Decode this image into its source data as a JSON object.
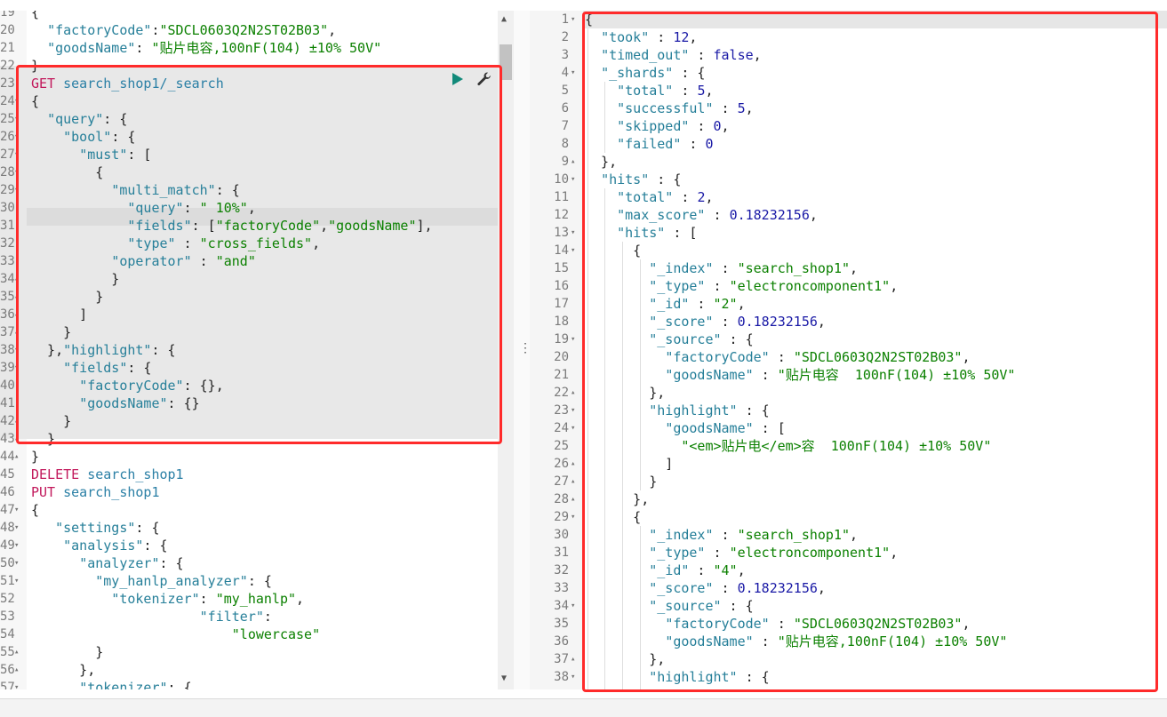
{
  "left_editor": {
    "lines": [
      {
        "n": "19",
        "fold": "",
        "text": "{"
      },
      {
        "n": "20",
        "fold": "",
        "text": "  \"factoryCode\":\"SDCL0603Q2N2ST02B03\","
      },
      {
        "n": "21",
        "fold": "",
        "text": "  \"goodsName\": \"贴片电容,100nF(104) ±10% 50V\""
      },
      {
        "n": "22",
        "fold": "",
        "text": "}"
      },
      {
        "n": "23",
        "fold": "",
        "text": "GET search_shop1/_search"
      },
      {
        "n": "24",
        "fold": "▾",
        "text": "{"
      },
      {
        "n": "25",
        "fold": "▾",
        "text": "  \"query\": {"
      },
      {
        "n": "26",
        "fold": "▾",
        "text": "    \"bool\": {"
      },
      {
        "n": "27",
        "fold": "▾",
        "text": "      \"must\": ["
      },
      {
        "n": "28",
        "fold": "▾",
        "text": "        {"
      },
      {
        "n": "29",
        "fold": "▾",
        "text": "          \"multi_match\": {"
      },
      {
        "n": "30",
        "fold": "",
        "text": "            \"query\": \" 10%\","
      },
      {
        "n": "31",
        "fold": "",
        "text": "            \"fields\": [\"factoryCode\",\"goodsName\"],"
      },
      {
        "n": "32",
        "fold": "",
        "text": "            \"type\" : \"cross_fields\","
      },
      {
        "n": "33",
        "fold": "",
        "text": "          \"operator\" : \"and\""
      },
      {
        "n": "34",
        "fold": "▴",
        "text": "          }"
      },
      {
        "n": "35",
        "fold": "▴",
        "text": "        }"
      },
      {
        "n": "36",
        "fold": "▴",
        "text": "      ]"
      },
      {
        "n": "37",
        "fold": "▴",
        "text": "    }"
      },
      {
        "n": "38",
        "fold": "▾",
        "text": "  },\"highlight\": {"
      },
      {
        "n": "39",
        "fold": "▾",
        "text": "    \"fields\": {"
      },
      {
        "n": "40",
        "fold": "",
        "text": "      \"factoryCode\": {},"
      },
      {
        "n": "41",
        "fold": "",
        "text": "      \"goodsName\": {}"
      },
      {
        "n": "42",
        "fold": "▴",
        "text": "    }"
      },
      {
        "n": "43",
        "fold": "▴",
        "text": "  }"
      },
      {
        "n": "44",
        "fold": "▴",
        "text": "}"
      },
      {
        "n": "45",
        "fold": "",
        "text": "DELETE search_shop1"
      },
      {
        "n": "46",
        "fold": "",
        "text": "PUT search_shop1"
      },
      {
        "n": "47",
        "fold": "▾",
        "text": "{"
      },
      {
        "n": "48",
        "fold": "▾",
        "text": "   \"settings\": {"
      },
      {
        "n": "49",
        "fold": "▾",
        "text": "    \"analysis\": {"
      },
      {
        "n": "50",
        "fold": "▾",
        "text": "      \"analyzer\": {"
      },
      {
        "n": "51",
        "fold": "▾",
        "text": "        \"my_hanlp_analyzer\": {"
      },
      {
        "n": "52",
        "fold": "",
        "text": "          \"tokenizer\": \"my_hanlp\","
      },
      {
        "n": "53",
        "fold": "",
        "text": "                     \"filter\":"
      },
      {
        "n": "54",
        "fold": "",
        "text": "                         \"lowercase\""
      },
      {
        "n": "55",
        "fold": "▴",
        "text": "        }"
      },
      {
        "n": "56",
        "fold": "▴",
        "text": "      },"
      },
      {
        "n": "57",
        "fold": "▾",
        "text": "      \"tokenizer\": {"
      }
    ]
  },
  "right_editor": {
    "lines": [
      {
        "n": "1",
        "fold": "▾",
        "text": "{"
      },
      {
        "n": "2",
        "fold": "",
        "text": "  \"took\" : 12,"
      },
      {
        "n": "3",
        "fold": "",
        "text": "  \"timed_out\" : false,"
      },
      {
        "n": "4",
        "fold": "▾",
        "text": "  \"_shards\" : {"
      },
      {
        "n": "5",
        "fold": "",
        "text": "    \"total\" : 5,"
      },
      {
        "n": "6",
        "fold": "",
        "text": "    \"successful\" : 5,"
      },
      {
        "n": "7",
        "fold": "",
        "text": "    \"skipped\" : 0,"
      },
      {
        "n": "8",
        "fold": "",
        "text": "    \"failed\" : 0"
      },
      {
        "n": "9",
        "fold": "▴",
        "text": "  },"
      },
      {
        "n": "10",
        "fold": "▾",
        "text": "  \"hits\" : {"
      },
      {
        "n": "11",
        "fold": "",
        "text": "    \"total\" : 2,"
      },
      {
        "n": "12",
        "fold": "",
        "text": "    \"max_score\" : 0.18232156,"
      },
      {
        "n": "13",
        "fold": "▾",
        "text": "    \"hits\" : ["
      },
      {
        "n": "14",
        "fold": "▾",
        "text": "      {"
      },
      {
        "n": "15",
        "fold": "",
        "text": "        \"_index\" : \"search_shop1\","
      },
      {
        "n": "16",
        "fold": "",
        "text": "        \"_type\" : \"electroncomponent1\","
      },
      {
        "n": "17",
        "fold": "",
        "text": "        \"_id\" : \"2\","
      },
      {
        "n": "18",
        "fold": "",
        "text": "        \"_score\" : 0.18232156,"
      },
      {
        "n": "19",
        "fold": "▾",
        "text": "        \"_source\" : {"
      },
      {
        "n": "20",
        "fold": "",
        "text": "          \"factoryCode\" : \"SDCL0603Q2N2ST02B03\","
      },
      {
        "n": "21",
        "fold": "",
        "text": "          \"goodsName\" : \"贴片电容  100nF(104) ±10% 50V\""
      },
      {
        "n": "22",
        "fold": "▴",
        "text": "        },"
      },
      {
        "n": "23",
        "fold": "▾",
        "text": "        \"highlight\" : {"
      },
      {
        "n": "24",
        "fold": "▾",
        "text": "          \"goodsName\" : ["
      },
      {
        "n": "25",
        "fold": "",
        "text": "            \"<em>贴片电</em>容  100nF(104) ±10% 50V\""
      },
      {
        "n": "26",
        "fold": "▴",
        "text": "          ]"
      },
      {
        "n": "27",
        "fold": "▴",
        "text": "        }"
      },
      {
        "n": "28",
        "fold": "▴",
        "text": "      },"
      },
      {
        "n": "29",
        "fold": "▾",
        "text": "      {"
      },
      {
        "n": "30",
        "fold": "",
        "text": "        \"_index\" : \"search_shop1\","
      },
      {
        "n": "31",
        "fold": "",
        "text": "        \"_type\" : \"electroncomponent1\","
      },
      {
        "n": "32",
        "fold": "",
        "text": "        \"_id\" : \"4\","
      },
      {
        "n": "33",
        "fold": "",
        "text": "        \"_score\" : 0.18232156,"
      },
      {
        "n": "34",
        "fold": "▾",
        "text": "        \"_source\" : {"
      },
      {
        "n": "35",
        "fold": "",
        "text": "          \"factoryCode\" : \"SDCL0603Q2N2ST02B03\","
      },
      {
        "n": "36",
        "fold": "",
        "text": "          \"goodsName\" : \"贴片电容,100nF(104) ±10% 50V\""
      },
      {
        "n": "37",
        "fold": "▴",
        "text": "        },"
      },
      {
        "n": "38",
        "fold": "▾",
        "text": "        \"highlight\" : {"
      }
    ]
  },
  "icons": {
    "run": "play-icon",
    "settings": "wrench-icon",
    "splitter": "drag-handle-icon"
  },
  "colors": {
    "highlight_box": "#ff2b2b",
    "method": "#c2185b",
    "run_button": "#128a7a"
  }
}
